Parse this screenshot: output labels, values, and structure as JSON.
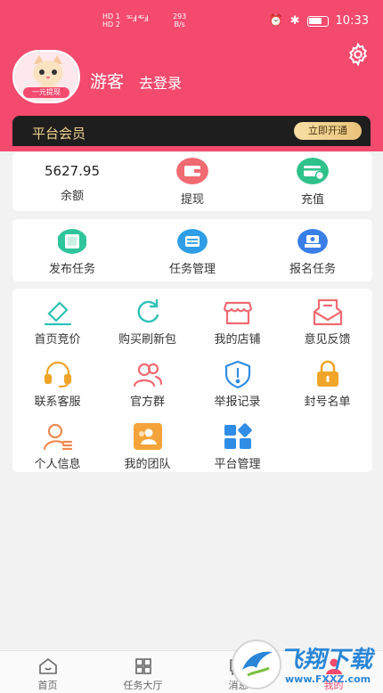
{
  "status_bar": {
    "network": "HD 1\nHD 2",
    "signal_bars": "⁵ᴳ.ıl ⁴ᴳ.ıl",
    "speed_value": "293",
    "speed_unit": "B/s",
    "time": "10:33"
  },
  "profile": {
    "avatar_tag": "一元提现",
    "username": "游客",
    "login_label": "去登录"
  },
  "vip": {
    "title": "平台会员",
    "button_label": "立即开通"
  },
  "wallet": {
    "balance_value": "5627.95",
    "balance_label": "余额",
    "withdraw_label": "提现",
    "recharge_label": "充值"
  },
  "tasks": [
    {
      "label": "发布任务",
      "icon": "publish-task-icon",
      "color": "#2fc59a"
    },
    {
      "label": "任务管理",
      "icon": "task-manage-icon",
      "color": "#2f9ee6"
    },
    {
      "label": "报名任务",
      "icon": "signup-task-icon",
      "color": "#3a7ee8"
    }
  ],
  "menu": [
    {
      "label": "首页竞价",
      "icon": "hammer-icon",
      "color": "#2fc1b5"
    },
    {
      "label": "购买刷新包",
      "icon": "refresh-icon",
      "color": "#2fc1b5"
    },
    {
      "label": "我的店铺",
      "icon": "shop-icon",
      "color": "#f06a72"
    },
    {
      "label": "意见反馈",
      "icon": "feedback-icon",
      "color": "#f06a72"
    },
    {
      "label": "联系客服",
      "icon": "headset-icon",
      "color": "#f0a52a"
    },
    {
      "label": "官方群",
      "icon": "group-icon",
      "color": "#f06a72"
    },
    {
      "label": "举报记录",
      "icon": "shield-icon",
      "color": "#2f8de6"
    },
    {
      "label": "封号名单",
      "icon": "lock-icon",
      "color": "#f0a52a"
    },
    {
      "label": "个人信息",
      "icon": "person-icon",
      "color": "#f08a50"
    },
    {
      "label": "我的团队",
      "icon": "team-icon",
      "color": "#f4a33a"
    },
    {
      "label": "平台管理",
      "icon": "platform-manage-icon",
      "color": "#2f8de6"
    }
  ],
  "tabbar": [
    {
      "label": "首页",
      "icon": "home-icon"
    },
    {
      "label": "任务大厅",
      "icon": "grid-icon"
    },
    {
      "label": "消息",
      "icon": "message-icon"
    },
    {
      "label": "我的",
      "icon": "user-icon"
    }
  ],
  "watermark": {
    "text": "飞翔下载",
    "url": "www.FXXZ.com"
  },
  "colors": {
    "brand": "#f44a6e",
    "withdraw_icon": "#f06a72",
    "recharge_icon": "#2fc18a"
  }
}
